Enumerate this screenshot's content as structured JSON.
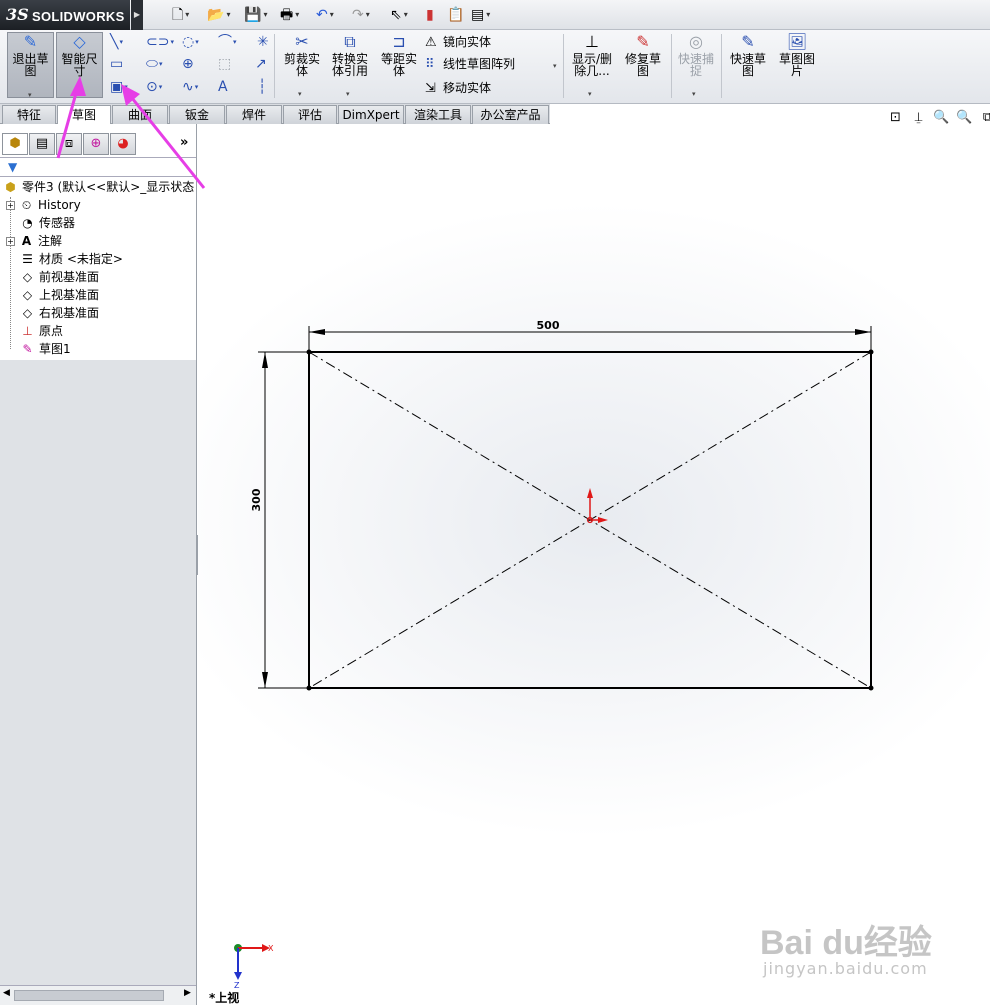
{
  "app": {
    "logo_ds": "3S",
    "logo_name": "SOLIDWORKS"
  },
  "quick_access": [
    "new-document",
    "open-folder",
    "save",
    "print",
    "undo",
    "redo",
    "select-pointer",
    "rebuild-light",
    "file-properties",
    "options"
  ],
  "ribbon": {
    "exit_sketch": "退出草\n图",
    "smart_dimension": "智能尺\n寸",
    "trim_entities": "剪裁实\n体",
    "convert_entities": "转换实\n体引用",
    "offset_entities": "等距实\n体",
    "mirror_entities": "镜向实体",
    "linear_pattern": "线性草图阵列",
    "move_entities": "移动实体",
    "display_delete": "显示/删\n除几...",
    "repair_sketch": "修复草\n图",
    "quick_snaps": "快速捕\n捉",
    "rapid_sketch": "快速草\n图",
    "sketch_picture": "草图图\n片"
  },
  "tabs": [
    "特征",
    "草图",
    "曲面",
    "钣金",
    "焊件",
    "评估",
    "DimXpert",
    "渲染工具",
    "办公室产品"
  ],
  "active_tab": "草图",
  "tree": {
    "root": "零件3 (默认<<默认>_显示状态",
    "items": [
      "History",
      "传感器",
      "注解",
      "材质 <未指定>",
      "前视基准面",
      "上视基准面",
      "右视基准面",
      "原点",
      "草图1"
    ]
  },
  "sketch": {
    "width_dim": "500",
    "height_dim": "300",
    "width_value": 500,
    "height_value": 300
  },
  "view_label": "*上视",
  "triad": {
    "x_label": "X",
    "z_label": "Z"
  },
  "watermark": {
    "brand": "Bai du经验",
    "url": "jingyan.baidu.com"
  },
  "colors": {
    "annotation_arrow": "#e63ee6",
    "origin_red": "#e01818",
    "sketch_line": "#000000"
  }
}
